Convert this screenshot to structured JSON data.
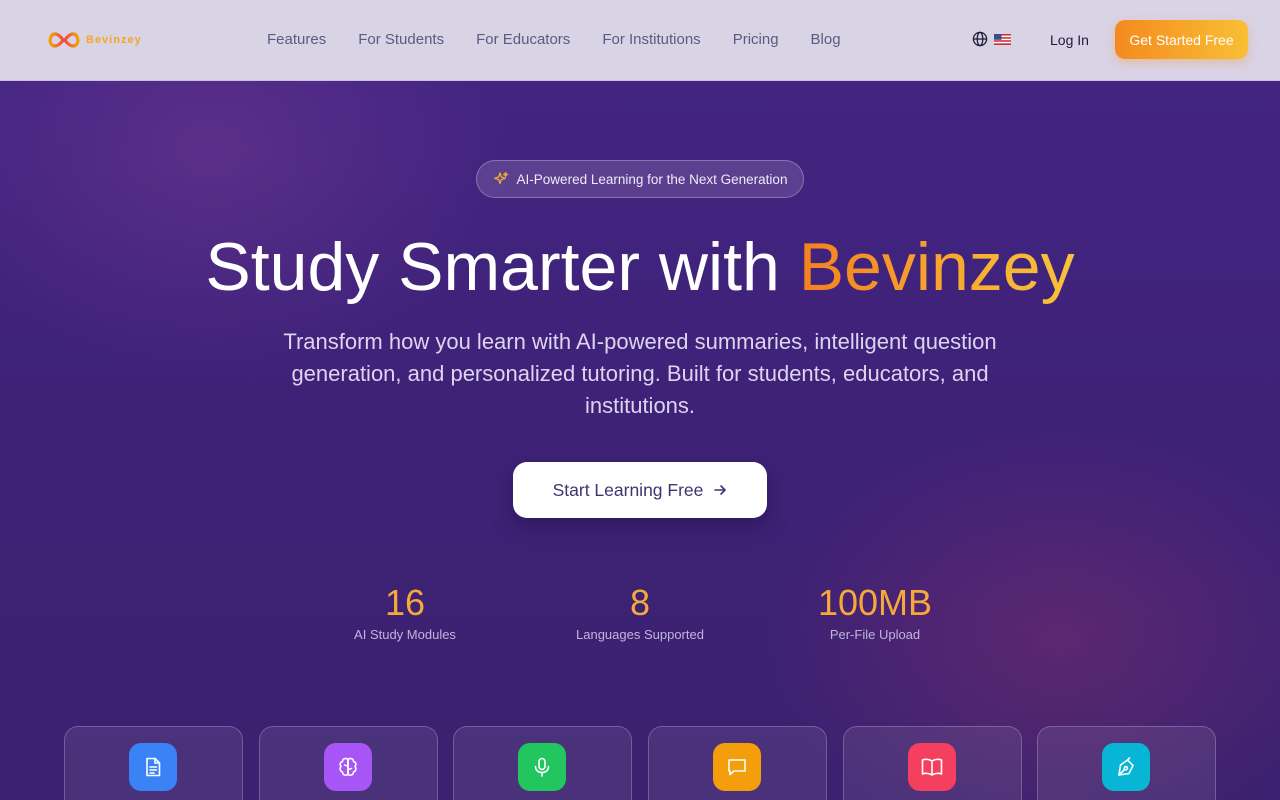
{
  "brand": {
    "name": "Bevinzey",
    "color": "#f5a623"
  },
  "nav": {
    "links": [
      "Features",
      "For Students",
      "For Educators",
      "For Institutions",
      "Pricing",
      "Blog"
    ],
    "login": "Log In",
    "cta": "Get Started Free",
    "language_icon": "globe-icon",
    "flag": "us-flag-icon"
  },
  "hero": {
    "badge": "AI-Powered Learning for the Next Generation",
    "title_prefix": "Study Smarter with",
    "title_brand": "Bevinzey",
    "subtitle": "Transform how you learn with AI-powered summaries, intelligent question generation, and personalized tutoring. Built for students, educators, and institutions.",
    "cta": "Start Learning Free"
  },
  "stats": [
    {
      "value": "16",
      "label": "AI Study Modules"
    },
    {
      "value": "8",
      "label": "Languages Supported"
    },
    {
      "value": "100MB",
      "label": "Per-File Upload"
    }
  ],
  "feature_cards": [
    {
      "icon": "document-icon",
      "color": "#3b82f6"
    },
    {
      "icon": "brain-icon",
      "color": "#a855f7"
    },
    {
      "icon": "microphone-icon",
      "color": "#22c55e"
    },
    {
      "icon": "chat-icon",
      "color": "#f59e0b"
    },
    {
      "icon": "book-icon",
      "color": "#f43f5e"
    },
    {
      "icon": "pen-icon",
      "color": "#06b6d4"
    }
  ],
  "colors": {
    "accent_orange": "#f48a1f",
    "accent_yellow": "#f9bf35",
    "hero_bg": "#3f2279",
    "nav_bg": "#d9d3e6"
  }
}
